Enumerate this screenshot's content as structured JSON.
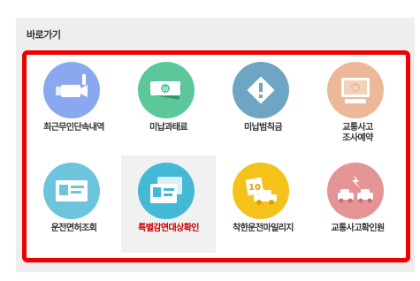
{
  "section": {
    "title": "바로가기"
  },
  "tiles": [
    {
      "label": "최근무인단속내역",
      "icon": "camera-icon",
      "color": "#8aa8f0"
    },
    {
      "label": "미납과태료",
      "icon": "money-icon",
      "color": "#5cc79a"
    },
    {
      "label": "미납범칙금",
      "icon": "warning-icon",
      "color": "#6ea5c2"
    },
    {
      "label": "교통사고\n조사예약",
      "icon": "reservation-monitor-icon",
      "color": "#ecb898"
    },
    {
      "label": "운전면허조회",
      "icon": "license-card-icon",
      "color": "#6cc4dd"
    },
    {
      "label": "특별감면대상확인",
      "icon": "id-cards-icon",
      "color": "#44b9d6",
      "highlight": "#cc0000"
    },
    {
      "label": "착한운전마일리지",
      "icon": "mileage-car-icon",
      "color": "#f4c21b"
    },
    {
      "label": "교통사고확인원",
      "icon": "accident-cars-icon",
      "color": "#e49495"
    }
  ]
}
